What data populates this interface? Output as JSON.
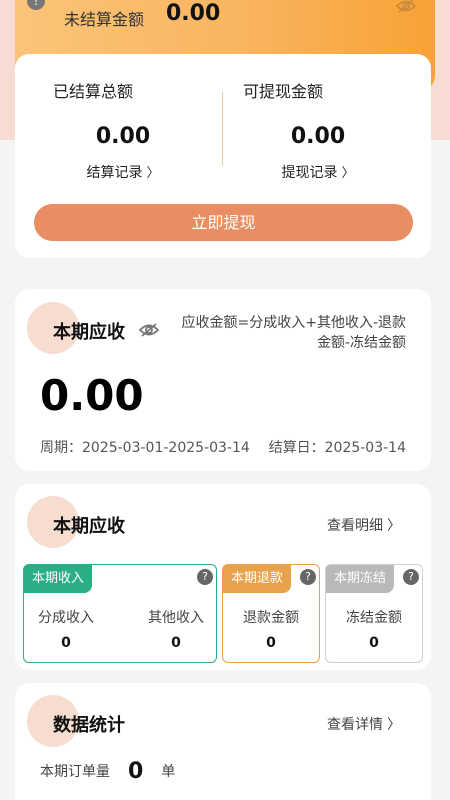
{
  "header": {
    "unsettled_label": "未结算金额",
    "unsettled_value": "0.00"
  },
  "settlement": {
    "settled_total_label": "已结算总额",
    "settled_total_value": "0.00",
    "settle_record_link": "结算记录",
    "withdrawable_label": "可提现金额",
    "withdrawable_value": "0.00",
    "withdraw_record_link": "提现记录",
    "withdraw_button": "立即提现"
  },
  "current_receivable": {
    "title": "本期应收",
    "formula_line1": "应收金额=分成收入+其他收入-退款",
    "formula_line2": "金额-冻结金额",
    "amount": "0.00",
    "period_label": "周期：2025-03-01-2025-03-14",
    "settle_date_label": "结算日：2025-03-14"
  },
  "receivable_detail": {
    "title": "本期应收",
    "view_detail_link": "查看明细",
    "income": {
      "tag": "本期收入",
      "share_label": "分成收入",
      "share_value": "0",
      "other_label": "其他收入",
      "other_value": "0"
    },
    "refund": {
      "tag": "本期退款",
      "label": "退款金额",
      "value": "0"
    },
    "frozen": {
      "tag": "本期冻结",
      "label": "冻结金额",
      "value": "0"
    }
  },
  "stats": {
    "title": "数据统计",
    "view_more_link": "查看详情",
    "orders_label": "本期订单量",
    "orders_value": "0",
    "orders_unit": "单"
  },
  "colors": {
    "accent": "#e98d63",
    "income_green": "#2bae86",
    "refund_orange": "#e9a24c",
    "frozen_gray": "#b9b9b9"
  }
}
